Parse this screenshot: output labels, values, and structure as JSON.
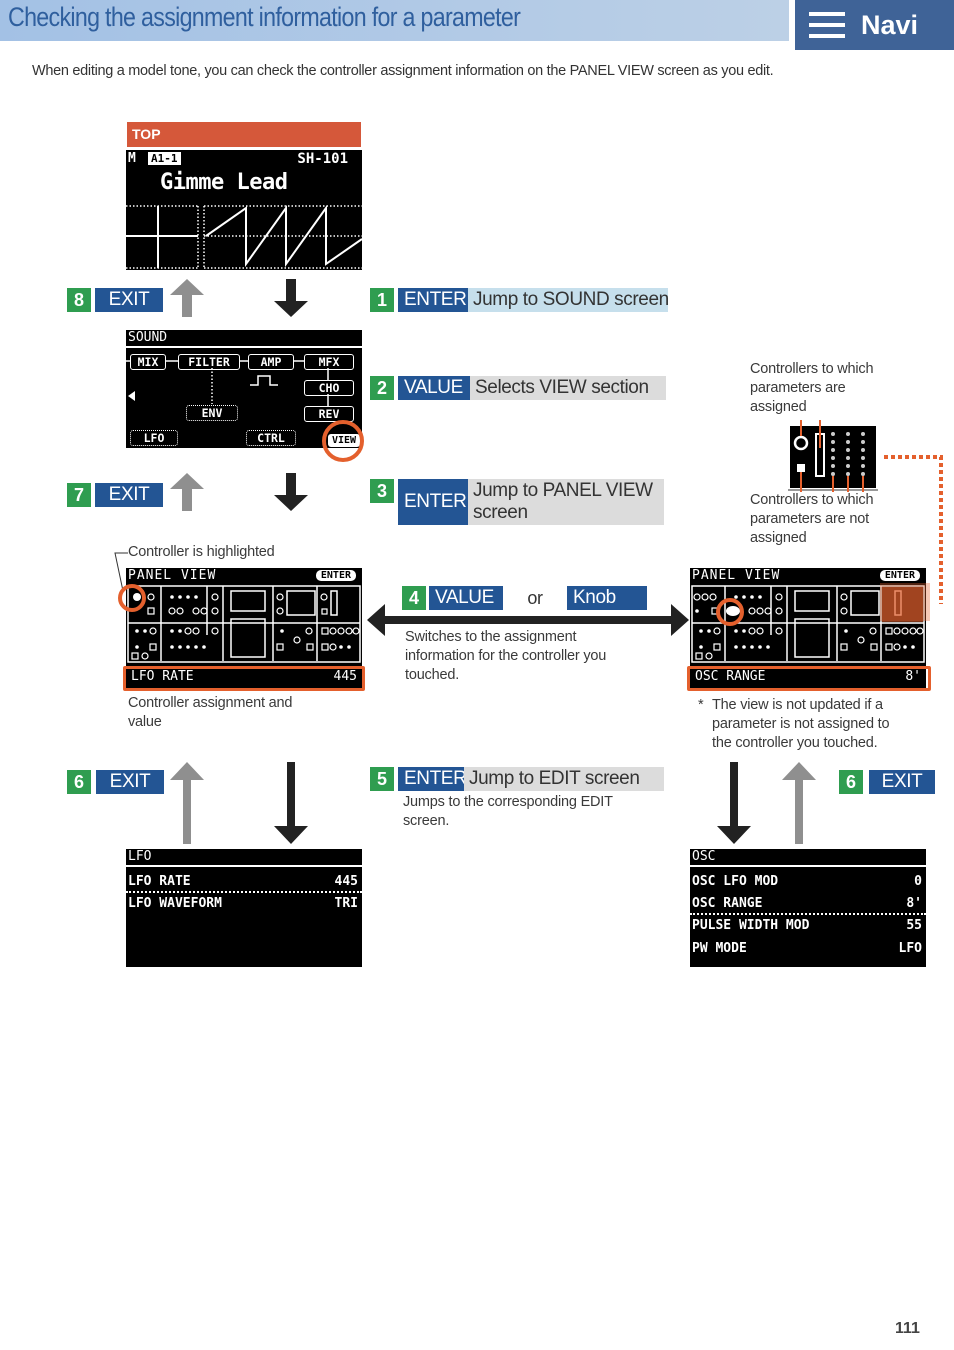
{
  "header": {
    "title": "Checking the assignment information for a parameter",
    "navi_label": "Navi",
    "intro": "When editing a model tone, you can check the controller assignment information on the PANEL VIEW screen as you edit."
  },
  "colors": {
    "step_number": "#2f9d50",
    "key_label": "#235594",
    "highlight": "#e4602d",
    "top_label": "#d5583a",
    "navi_bg": "#3f6397"
  },
  "top_screen": {
    "label": "TOP",
    "mode": "M",
    "patch": "A1-1",
    "model": "SH-101",
    "tone_name": "Gimme Lead"
  },
  "sound_screen": {
    "title": "SOUND",
    "blocks": [
      "MIX",
      "FILTER",
      "AMP",
      "MFX",
      "CHO",
      "REV",
      "ENV",
      "LFO",
      "CTRL",
      "VIEW"
    ]
  },
  "panel_view_left": {
    "title": "PANEL VIEW",
    "enter_tag": "ENTER",
    "param_name": "LFO RATE",
    "param_value": "445",
    "callout_top": "Controller is highlighted",
    "callout_bottom": "Controller assignment and value"
  },
  "panel_view_right": {
    "title": "PANEL VIEW",
    "enter_tag": "ENTER",
    "param_name": "OSC RANGE",
    "param_value": "8'",
    "footnote_mark": "*",
    "footnote": "The view is not updated if a parameter is not assigned to the controller you touched."
  },
  "legend": {
    "assigned": "Controllers to which parameters are assigned",
    "not_assigned": "Controllers to which parameters are not assigned"
  },
  "lfo_screen": {
    "title": "LFO",
    "rows": [
      {
        "name": "LFO RATE",
        "value": "445"
      },
      {
        "name": "LFO WAVEFORM",
        "value": "TRI"
      }
    ]
  },
  "osc_screen": {
    "title": "OSC",
    "rows": [
      {
        "name": "OSC LFO MOD",
        "value": "0"
      },
      {
        "name": "OSC RANGE",
        "value": "8'"
      },
      {
        "name": "PULSE WIDTH MOD",
        "value": "55"
      },
      {
        "name": "PW MODE",
        "value": "LFO"
      }
    ]
  },
  "steps": {
    "s1": {
      "num": "1",
      "key": "ENTER",
      "desc": "Jump to SOUND screen"
    },
    "s2": {
      "num": "2",
      "key": "VALUE",
      "desc": "Selects VIEW section"
    },
    "s3": {
      "num": "3",
      "key": "ENTER",
      "desc": "Jump to PANEL VIEW screen"
    },
    "s4": {
      "num": "4",
      "key": "VALUE",
      "or": "or",
      "key2": "Knob",
      "desc": "Switches to the assignment information for the controller you touched."
    },
    "s5": {
      "num": "5",
      "key": "ENTER",
      "desc": "Jump to EDIT screen",
      "sub": "Jumps to the corresponding EDIT screen."
    },
    "s6_left": {
      "num": "6",
      "key": "EXIT"
    },
    "s6_right": {
      "num": "6",
      "key": "EXIT"
    },
    "s7": {
      "num": "7",
      "key": "EXIT"
    },
    "s8": {
      "num": "8",
      "key": "EXIT"
    }
  },
  "page_number": "111"
}
